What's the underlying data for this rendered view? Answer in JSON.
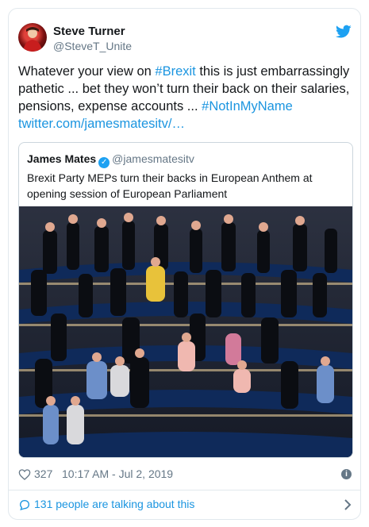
{
  "tweet": {
    "author_name": "Steve Turner",
    "author_handle": "@SteveT_Unite",
    "text_before": "Whatever your view on ",
    "hashtag1": "#Brexit",
    "text_middle": " this is just embarrassingly pathetic ... bet they won’t turn their back on their salaries, pensions, expense accounts ... ",
    "hashtag2": "#NotInMyName",
    "link": "twitter.com/jamesmatesitv/…",
    "likes": "327",
    "timestamp": "10:17 AM - Jul 2, 2019",
    "talking": "131 people are talking about this"
  },
  "quoted": {
    "author_name": "James Mates",
    "author_handle": "@jamesmatesitv",
    "text": "Brexit Party MEPs turn their backs in European Anthem at opening session of European Parliament"
  },
  "colors": {
    "link": "#1b95e0",
    "brand": "#1da1f2",
    "muted": "#657786"
  }
}
